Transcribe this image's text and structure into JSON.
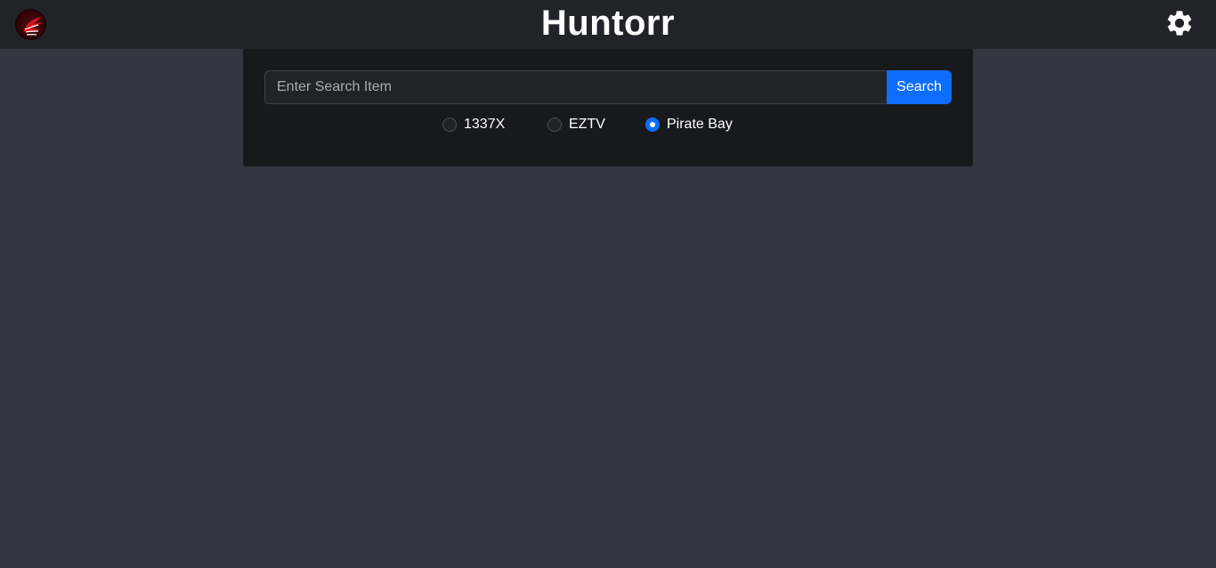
{
  "header": {
    "title": "Huntorr",
    "logo_icon": "phoenix-logo-icon",
    "settings_icon": "gear-icon"
  },
  "search": {
    "placeholder": "Enter Search Item",
    "value": "",
    "button_label": "Search"
  },
  "sources": [
    {
      "label": "1337X",
      "checked": false
    },
    {
      "label": "EZTV",
      "checked": false
    },
    {
      "label": "Pirate Bay",
      "checked": true
    }
  ],
  "colors": {
    "page_background": "#343741",
    "header_background": "#212329",
    "panel_background": "#18191d",
    "accent": "#0d6efd",
    "logo_red": "#c8102e"
  }
}
